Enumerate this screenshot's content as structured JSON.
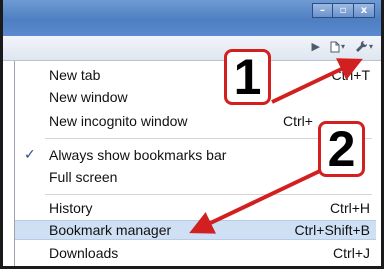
{
  "window": {
    "minimize": "–",
    "maximize": "▫",
    "close": "x"
  },
  "toolbar": {
    "icons": [
      "play-icon",
      "page-icon",
      "wrench-icon"
    ]
  },
  "menu": {
    "items": [
      {
        "label": "New tab",
        "shortcut": "Ctrl+T"
      },
      {
        "label": "New window",
        "shortcut": ""
      },
      {
        "label": "New incognito window",
        "shortcut": "Ctrl+"
      },
      {
        "label": "Always show bookmarks bar",
        "shortcut": "",
        "checked": true
      },
      {
        "label": "Full screen",
        "shortcut": ""
      },
      {
        "label": "History",
        "shortcut": "Ctrl+H"
      },
      {
        "label": "Bookmark manager",
        "shortcut": "Ctrl+Shift+B",
        "highlighted": true
      },
      {
        "label": "Downloads",
        "shortcut": "Ctrl+J"
      }
    ]
  },
  "callouts": {
    "one": "1",
    "two": "2"
  },
  "colors": {
    "callout_border": "#d22020",
    "arrow": "#d22020",
    "highlight": "#cfe0f5",
    "titlebar": "#4e7fc1"
  }
}
